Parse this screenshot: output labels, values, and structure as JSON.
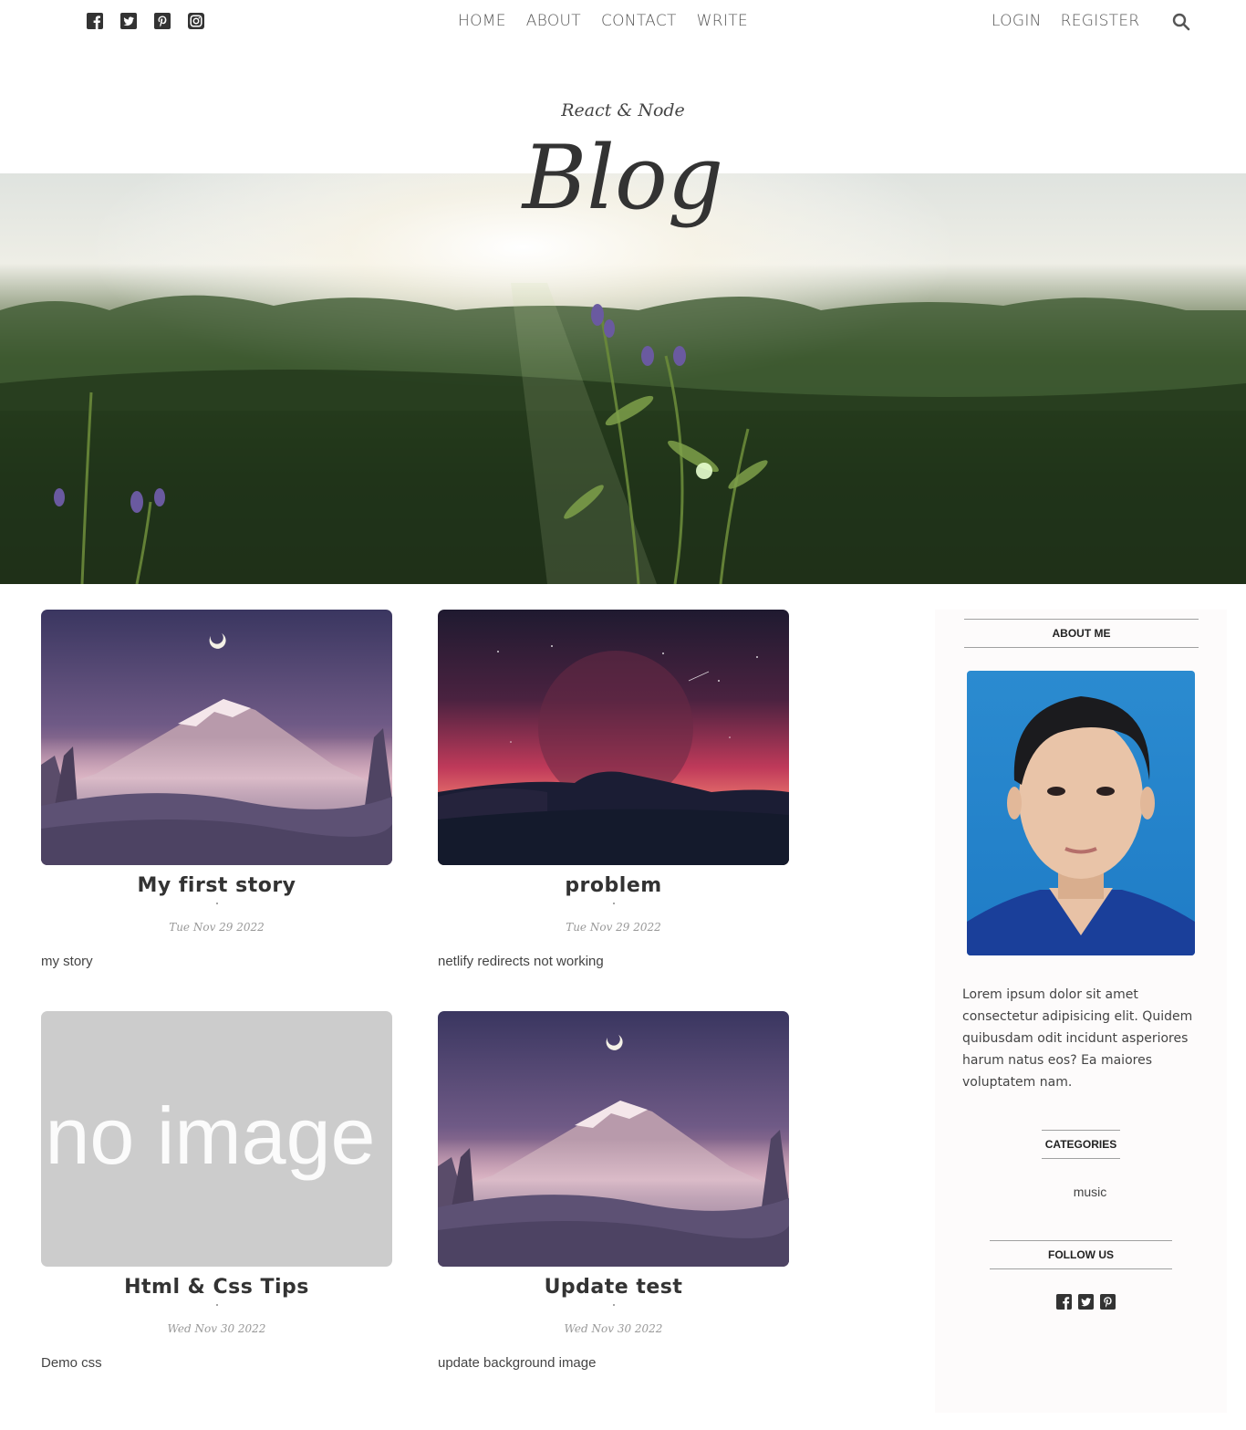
{
  "top_nav": {
    "social_icons": [
      "facebook-icon",
      "twitter-icon",
      "pinterest-icon",
      "instagram-icon"
    ],
    "links": [
      "HOME",
      "ABOUT",
      "CONTACT",
      "WRITE"
    ],
    "auth": [
      "LOGIN",
      "REGISTER"
    ],
    "search_icon": "search-icon"
  },
  "header": {
    "subtitle": "React & Node",
    "title": "Blog"
  },
  "posts": [
    {
      "title": "My first story",
      "date": "Tue Nov 29 2022",
      "desc": "my story",
      "image": "mountain-night"
    },
    {
      "title": "problem",
      "date": "Tue Nov 29 2022",
      "desc": "netlify redirects not working",
      "image": "sunset-moon"
    },
    {
      "title": "Html & Css Tips",
      "date": "Wed Nov 30 2022",
      "desc": "Demo css",
      "image": "no image"
    },
    {
      "title": "Update test",
      "date": "Wed Nov 30 2022",
      "desc": "update background image",
      "image": "mountain-night"
    }
  ],
  "sidebar": {
    "about_heading": "ABOUT ME",
    "about_text": "Lorem ipsum dolor sit amet consectetur adipisicing elit. Quidem quibusdam odit incidunt asperiores harum natus eos? Ea maiores voluptatem nam.",
    "categories_heading": "CATEGORIES",
    "categories": [
      "music"
    ],
    "follow_heading": "FOLLOW US",
    "follow_icons": [
      "facebook-icon",
      "twitter-icon",
      "pinterest-icon"
    ]
  },
  "colors": {
    "text": "#444444",
    "sidebar_bg": "#fdfbfb",
    "noimage_bg": "#cccccc"
  }
}
